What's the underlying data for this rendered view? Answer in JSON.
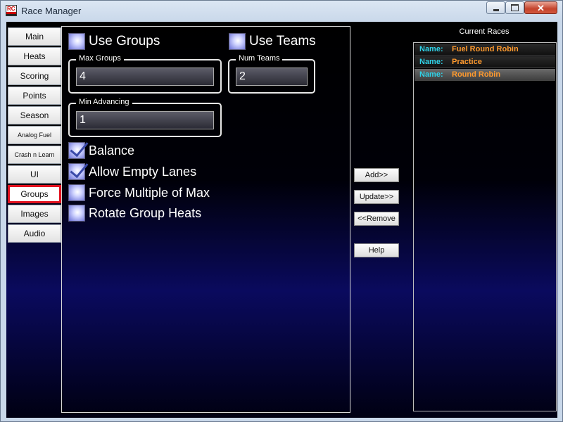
{
  "window": {
    "title": "Race Manager",
    "app_icon_text": "RC",
    "close_glyph": "✕"
  },
  "nav": {
    "items": [
      {
        "label": "Main"
      },
      {
        "label": "Heats"
      },
      {
        "label": "Scoring"
      },
      {
        "label": "Points"
      },
      {
        "label": "Season"
      },
      {
        "label": "Analog Fuel"
      },
      {
        "label": "Crash n Learn"
      },
      {
        "label": "UI"
      },
      {
        "label": "Groups"
      },
      {
        "label": "Images"
      },
      {
        "label": "Audio"
      }
    ],
    "active": "Groups"
  },
  "settings": {
    "use_groups": {
      "label": "Use Groups",
      "checked": false
    },
    "use_teams": {
      "label": "Use Teams",
      "checked": false
    },
    "max_groups": {
      "legend": "Max Groups",
      "value": "4"
    },
    "num_teams": {
      "legend": "Num Teams",
      "value": "2"
    },
    "min_advancing": {
      "legend": "Min Advancing",
      "value": "1"
    },
    "balance": {
      "label": "Balance",
      "checked": true
    },
    "allow_empty_lanes": {
      "label": "Allow Empty Lanes",
      "checked": true
    },
    "force_multiple_of_max": {
      "label": "Force Multiple of Max",
      "checked": false
    },
    "rotate_group_heats": {
      "label": "Rotate Group Heats",
      "checked": false
    }
  },
  "actions": {
    "add": "Add>>",
    "update": "Update>>",
    "remove": "<<Remove",
    "help": "Help"
  },
  "races": {
    "title": "Current Races",
    "key_label": "Name:",
    "items": [
      {
        "name": "Fuel Round Robin",
        "selected": false
      },
      {
        "name": "Practice",
        "selected": false
      },
      {
        "name": "Round Robin",
        "selected": true
      }
    ]
  },
  "colors": {
    "active_tab_border": "#e2121f",
    "race_key": "#2fd2e8",
    "race_value": "#ff9a2e"
  }
}
